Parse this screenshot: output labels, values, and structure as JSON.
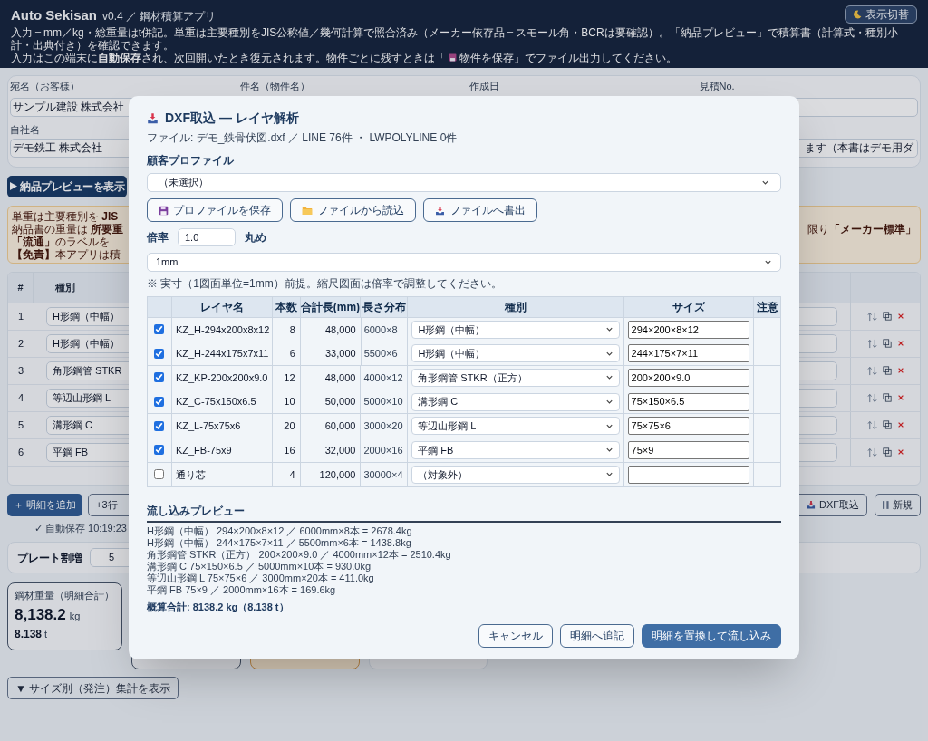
{
  "header": {
    "title": "Auto Sekisan",
    "version": "v0.4 ／ 鋼材積算アプリ",
    "description_1": "入力＝mm／kg・総重量はt併記。単重は主要種別をJIS公称値／幾何計算で照合済み（メーカー依存品＝スモール角・BCRは要確認）。「納品プレビュー」で積算書（計算式・種別小計・出典付き）を確認できます。",
    "description_2_before": "入力はこの端末に**自動保存**され、次回開いたとき復元されます。物件ごとに残すときは「",
    "description_2_after": "物件を保存」でファイル出力してください。",
    "theme_button": "表示切替"
  },
  "form": {
    "labels": [
      "宛名（お客様）",
      "件名（物件名）",
      "作成日",
      "見積No."
    ],
    "customer": "サンプル建設 株式会社",
    "company_label": "自社名",
    "company": "デモ鉄工 株式会社",
    "note_field": "ます（本書はデモ用ダ"
  },
  "preview_button": "納品プレビューを表示",
  "notice": {
    "left_lines": [
      "単重は主要種別を **JIS**",
      "納品書の重量は **所要重**",
      "**「流通」**のラベルを",
      "**【免責】**本アプリは積"
    ],
    "right_line": "限り**「メーカー標準」**"
  },
  "table": {
    "columns": [
      "#",
      "種別"
    ],
    "rows": [
      {
        "no": "1",
        "type": "H形鋼（中幅）"
      },
      {
        "no": "2",
        "type": "H形鋼（中幅）"
      },
      {
        "no": "3",
        "type": "角形鋼管 STKR"
      },
      {
        "no": "4",
        "type": "等辺山形鋼 L"
      },
      {
        "no": "5",
        "type": "溝形鋼 C"
      },
      {
        "no": "6",
        "type": "平鋼 FB"
      }
    ]
  },
  "actions": {
    "add": "＋ 明細を追加",
    "add3": "+3行",
    "dxf": "DXF取込",
    "new": "新規"
  },
  "autosave": "✓ 自動保存 10:19:23",
  "plate": {
    "label": "プレート割増",
    "value": "5"
  },
  "weight_card": {
    "label": "鋼材重量（明細合計）",
    "value": "8,138.2",
    "unit": "kg",
    "tons": "8.138",
    "tons_unit": "t"
  },
  "size_summary_button": "▼ サイズ別（発注）集計を表示",
  "dialog": {
    "title": "DXF取込 — レイヤ解析",
    "file_info": "ファイル: デモ_鉄骨伏図.dxf ／ LINE 76件 ・ LWPOLYLINE 0件",
    "profile_label": "顧客プロファイル",
    "profile_select": "（未選択）",
    "profile_buttons": [
      {
        "kind": "save",
        "label": "プロファイルを保存"
      },
      {
        "kind": "load",
        "label": "ファイルから読込"
      },
      {
        "kind": "export",
        "label": "ファイルへ書出"
      }
    ],
    "scale_label": "倍率",
    "scale": "1.0",
    "rounding_label": "丸め",
    "rounding": "1mm",
    "note": "※ 実寸（1図面単位=1mm）前提。縮尺図面は倍率で調整してください。",
    "columns": [
      "レイヤ名",
      "本数",
      "合計長(mm)",
      "長さ分布",
      "種別",
      "サイズ",
      "注意"
    ],
    "rows": [
      {
        "checked": true,
        "layer": "KZ_H-294x200x8x12",
        "count": "8",
        "total": "48,000",
        "dist": "6000×8",
        "type": "H形鋼（中幅）",
        "size": "294×200×8×12"
      },
      {
        "checked": true,
        "layer": "KZ_H-244x175x7x11",
        "count": "6",
        "total": "33,000",
        "dist": "5500×6",
        "type": "H形鋼（中幅）",
        "size": "244×175×7×11"
      },
      {
        "checked": true,
        "layer": "KZ_KP-200x200x9.0",
        "count": "12",
        "total": "48,000",
        "dist": "4000×12",
        "type": "角形鋼管 STKR（正方）",
        "size": "200×200×9.0"
      },
      {
        "checked": true,
        "layer": "KZ_C-75x150x6.5",
        "count": "10",
        "total": "50,000",
        "dist": "5000×10",
        "type": "溝形鋼 C",
        "size": "75×150×6.5"
      },
      {
        "checked": true,
        "layer": "KZ_L-75x75x6",
        "count": "20",
        "total": "60,000",
        "dist": "3000×20",
        "type": "等辺山形鋼 L",
        "size": "75×75×6"
      },
      {
        "checked": true,
        "layer": "KZ_FB-75x9",
        "count": "16",
        "total": "32,000",
        "dist": "2000×16",
        "type": "平鋼 FB",
        "size": "75×9"
      },
      {
        "checked": false,
        "layer": "通り芯",
        "count": "4",
        "total": "120,000",
        "dist": "30000×4",
        "type": "（対象外）",
        "size": ""
      }
    ],
    "preview_title": "流し込みプレビュー",
    "preview_lines": [
      "H形鋼（中幅） 294×200×8×12 ／ 6000mm×8本 = 2678.4kg",
      "H形鋼（中幅） 244×175×7×11 ／ 5500mm×6本 = 1438.8kg",
      "角形鋼管 STKR（正方） 200×200×9.0 ／ 4000mm×12本 = 2510.4kg",
      "溝形鋼 C 75×150×6.5 ／ 5000mm×10本 = 930.0kg",
      "等辺山形鋼 L 75×75×6 ／ 3000mm×20本 = 411.0kg",
      "平鋼 FB 75×9 ／ 2000mm×16本 = 169.6kg"
    ],
    "total": "概算合計: 8138.2 kg（8.138 t）",
    "buttons": [
      {
        "kind": "secondary",
        "label": "キャンセル"
      },
      {
        "kind": "secondary",
        "label": "明細へ追記"
      },
      {
        "kind": "primary",
        "label": "明細を置換して流し込み"
      }
    ]
  }
}
